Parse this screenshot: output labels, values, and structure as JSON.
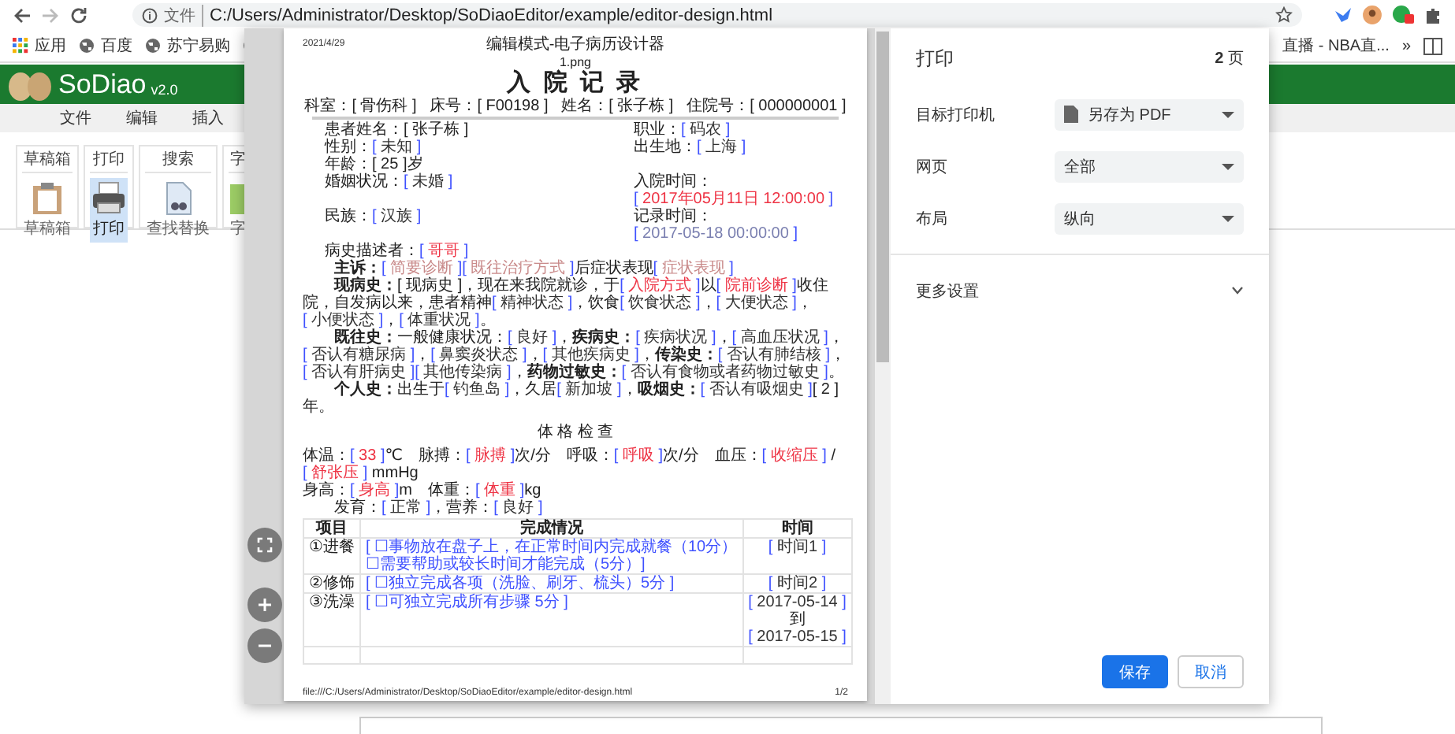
{
  "browser": {
    "scheme_label": "文件",
    "url": "C:/Users/Administrator/Desktop/SoDiaoEditor/example/editor-design.html",
    "bookmarks": [
      {
        "kind": "apps",
        "label": "应用"
      },
      {
        "kind": "site",
        "label": "百度"
      },
      {
        "kind": "site",
        "label": "苏宁易购"
      },
      {
        "kind": "site"
      }
    ],
    "right_bookmark": "直播 - NBA直...",
    "overflow": "»"
  },
  "app": {
    "logo": "SoDiao",
    "version": "v2.0",
    "menu": [
      "文件",
      "编辑",
      "插入"
    ],
    "toolbar": [
      {
        "title": "草稿箱",
        "label": "草稿箱",
        "selected": false
      },
      {
        "title": "打印",
        "label": "打印",
        "selected": true
      },
      {
        "title": "搜索",
        "label": "查找替换",
        "selected": false
      },
      {
        "title": "字",
        "label": "字",
        "selected": false
      }
    ]
  },
  "print_dialog": {
    "preview": {
      "header_date": "2021/4/29",
      "header_title": "编辑模式-电子病历设计器",
      "image_alt": "1.png",
      "title": "入 院 记 录",
      "info": [
        {
          "label": "科室：",
          "value": "[ 骨伤科 ]"
        },
        {
          "label": "床号：",
          "value": "[ F00198 ]"
        },
        {
          "label": "姓名：",
          "value": "[ 张子栋 ]"
        },
        {
          "label": "住院号：",
          "value": "[ 000000001 ]"
        }
      ],
      "fields": [
        {
          "left": [
            {
              "kind": "text",
              "text": "患者姓名："
            },
            {
              "kind": "plain",
              "text": "[ 张子栋 ]"
            }
          ],
          "right": [
            {
              "kind": "text",
              "text": "职业："
            },
            {
              "kind": "select",
              "text": "[ 码农 ]"
            }
          ]
        },
        {
          "left": [
            {
              "kind": "text",
              "text": "性别："
            },
            {
              "kind": "select",
              "text": "[ 未知 ]"
            }
          ],
          "right": [
            {
              "kind": "text",
              "text": "出生地："
            },
            {
              "kind": "select",
              "text": "[ 上海 ]"
            }
          ]
        },
        {
          "left": [
            {
              "kind": "text",
              "text": "年龄："
            },
            {
              "kind": "plain",
              "text": "[ 25 ]"
            },
            {
              "kind": "text",
              "text": "岁"
            }
          ]
        },
        {
          "left": [
            {
              "kind": "text",
              "text": "婚姻状况："
            },
            {
              "kind": "select",
              "text": "[ 未婚 ]"
            }
          ],
          "right": [
            {
              "kind": "text",
              "text": "入院时间："
            },
            {
              "kind": "required",
              "text": "[ 2017年05月11日 12:00:00 ]"
            }
          ]
        },
        {
          "left": [
            {
              "kind": "text",
              "text": "民族："
            },
            {
              "kind": "select",
              "text": "[ 汉族 ]"
            }
          ],
          "right": [
            {
              "kind": "text",
              "text": "记录时间："
            },
            {
              "kind": "date",
              "text": "[ 2017-05-18 00:00:00 ]"
            }
          ]
        },
        {
          "left": [
            {
              "kind": "text",
              "text": "病史描述者："
            },
            {
              "kind": "required",
              "text": "[ 哥哥 ]"
            }
          ]
        }
      ],
      "paragraphs": [
        [
          {
            "kind": "bold",
            "text": "主诉："
          },
          {
            "kind": "hint",
            "text": "[ 简要诊断 ]"
          },
          {
            "kind": "hint",
            "text": "[ 既往治疗方式 ]"
          },
          {
            "kind": "text",
            "text": "后症状表现"
          },
          {
            "kind": "hint",
            "text": "[ 症状表现 ]"
          }
        ],
        [
          {
            "kind": "bold",
            "text": "现病史："
          },
          {
            "kind": "plain",
            "text": "[ 现病史 ]"
          },
          {
            "kind": "text",
            "text": "，现在来我院就诊，于"
          },
          {
            "kind": "required",
            "text": "[ 入院方式 ]"
          },
          {
            "kind": "text",
            "text": "以"
          },
          {
            "kind": "required",
            "text": "[ 院前诊断 ]"
          },
          {
            "kind": "text",
            "text": "收住院，自发病以来，患者精神"
          },
          {
            "kind": "select",
            "text": "[ 精神状态 ]"
          },
          {
            "kind": "text",
            "text": "，饮食"
          },
          {
            "kind": "select",
            "text": "[ 饮食状态 ]"
          },
          {
            "kind": "text",
            "text": "，"
          },
          {
            "kind": "select",
            "text": "[ 大便状态 ]"
          },
          {
            "kind": "text",
            "text": "，"
          },
          {
            "kind": "select",
            "text": "[ 小便状态 ]"
          },
          {
            "kind": "text",
            "text": "，"
          },
          {
            "kind": "select",
            "text": "[ 体重状况 ]"
          },
          {
            "kind": "text",
            "text": "。"
          }
        ],
        [
          {
            "kind": "bold",
            "text": "既往史："
          },
          {
            "kind": "text",
            "text": "一般健康状况："
          },
          {
            "kind": "select",
            "text": "[ 良好 ]"
          },
          {
            "kind": "text",
            "text": "，"
          },
          {
            "kind": "bold",
            "text": "疾病史："
          },
          {
            "kind": "select",
            "text": "[ 疾病状况 ]"
          },
          {
            "kind": "text",
            "text": "，"
          },
          {
            "kind": "select",
            "text": "[ 高血压状况 ]"
          },
          {
            "kind": "text",
            "text": "，"
          },
          {
            "kind": "select",
            "text": "[ 否认有糖尿病 ]"
          },
          {
            "kind": "text",
            "text": "，"
          },
          {
            "kind": "select",
            "text": "[ 鼻窦炎状态 ]"
          },
          {
            "kind": "text",
            "text": "，"
          },
          {
            "kind": "select",
            "text": "[ 其他疾病史 ]"
          },
          {
            "kind": "text",
            "text": "，"
          },
          {
            "kind": "bold",
            "text": "传染史："
          },
          {
            "kind": "select",
            "text": "[ 否认有肺结核 ]"
          },
          {
            "kind": "text",
            "text": "，"
          },
          {
            "kind": "select",
            "text": "[ 否认有肝病史 ]"
          },
          {
            "kind": "select",
            "text": "[ 其他传染病 ]"
          },
          {
            "kind": "text",
            "text": "，"
          },
          {
            "kind": "bold",
            "text": "药物过敏史："
          },
          {
            "kind": "select",
            "text": "[ 否认有食物或者药物过敏史 ]"
          },
          {
            "kind": "text",
            "text": "。"
          }
        ],
        [
          {
            "kind": "bold",
            "text": "个人史："
          },
          {
            "kind": "text",
            "text": "出生于"
          },
          {
            "kind": "select",
            "text": "[ 钓鱼岛 ]"
          },
          {
            "kind": "text",
            "text": "，久居"
          },
          {
            "kind": "select",
            "text": "[ 新加坡 ]"
          },
          {
            "kind": "text",
            "text": "，"
          },
          {
            "kind": "bold",
            "text": "吸烟史："
          },
          {
            "kind": "select",
            "text": "[ 否认有吸烟史 ]"
          },
          {
            "kind": "plain",
            "text": "[ 2 ]"
          },
          {
            "kind": "text",
            "text": "年。"
          }
        ]
      ],
      "section_title": "体 格 检 查",
      "vitals": [
        {
          "indent": false,
          "segments": [
            {
              "kind": "text",
              "text": "体温："
            },
            {
              "kind": "required",
              "text": "[ 33 ]"
            },
            {
              "kind": "text",
              "text": "℃　脉搏："
            },
            {
              "kind": "required",
              "text": "[ 脉搏 ]"
            },
            {
              "kind": "text",
              "text": "次/分　呼吸："
            },
            {
              "kind": "required",
              "text": "[ 呼吸 ]"
            },
            {
              "kind": "text",
              "text": "次/分　血压："
            },
            {
              "kind": "required",
              "text": "[ 收缩压 ]"
            },
            {
              "kind": "text",
              "text": " / "
            },
            {
              "kind": "required",
              "text": "[ 舒张压 ]"
            },
            {
              "kind": "text",
              "text": " mmHg"
            }
          ]
        },
        {
          "indent": false,
          "segments": [
            {
              "kind": "text",
              "text": "身高："
            },
            {
              "kind": "required",
              "text": "[ 身高 ]"
            },
            {
              "kind": "text",
              "text": "m　体重："
            },
            {
              "kind": "required",
              "text": "[ 体重 ]"
            },
            {
              "kind": "text",
              "text": "kg"
            }
          ]
        },
        {
          "indent": true,
          "segments": [
            {
              "kind": "text",
              "text": "发育："
            },
            {
              "kind": "select",
              "text": "[ 正常 ]"
            },
            {
              "kind": "text",
              "text": "，营养："
            },
            {
              "kind": "select",
              "text": "[ 良好 ]"
            }
          ]
        }
      ],
      "table": {
        "columns": [
          "项目",
          "完成情况",
          "时间"
        ],
        "rows": [
          {
            "kind": "entry",
            "item": "①进餐",
            "completion": [
              [
                {
                  "kind": "link",
                  "text": "[ ☐事物放在盘子上，在正常时间内完成就餐（10分）"
                }
              ],
              [
                {
                  "kind": "link",
                  "text": "☐需要帮助或较长时间才能完成（5分）]"
                }
              ]
            ],
            "time": [
              [
                {
                  "kind": "select",
                  "text": "[ 时间1 ]"
                }
              ]
            ]
          },
          {
            "kind": "entry",
            "item": "②修饰",
            "completion": [
              [
                {
                  "kind": "link",
                  "text": "[ ☐独立完成各项（洗脸、刷牙、梳头）5分 ]"
                }
              ]
            ],
            "time": [
              [
                {
                  "kind": "select",
                  "text": "[ 时间2 ]"
                }
              ]
            ]
          },
          {
            "kind": "entry",
            "item": "③洗澡",
            "completion": [
              [
                {
                  "kind": "link",
                  "text": "[ ☐可独立完成所有步骤 5分 ]"
                }
              ]
            ],
            "time": [
              [
                {
                  "kind": "select",
                  "text": "[ 2017-05-14 ]"
                }
              ],
              [
                {
                  "kind": "text",
                  "text": "到"
                }
              ],
              [
                {
                  "kind": "select",
                  "text": "[ 2017-05-15 ]"
                }
              ]
            ]
          },
          {
            "kind": "blank"
          }
        ]
      },
      "footer_path": "file:///C:/Users/Administrator/Desktop/SoDiaoEditor/example/editor-design.html",
      "footer_page": "1/2"
    },
    "panel": {
      "title": "打印",
      "page_count": "**2** 页",
      "settings": [
        {
          "kind": "printer",
          "label": "目标打印机",
          "value": "另存为 PDF"
        },
        {
          "kind": "plain",
          "label": "网页",
          "value": "全部"
        },
        {
          "kind": "plain",
          "label": "布局",
          "value": "纵向"
        }
      ],
      "more_settings": {
        "label": "更多设置",
        "expanded": false
      },
      "buttons": [
        {
          "kind": "primary",
          "label": "保存"
        },
        {
          "kind": "secondary",
          "label": "取消"
        }
      ]
    }
  }
}
